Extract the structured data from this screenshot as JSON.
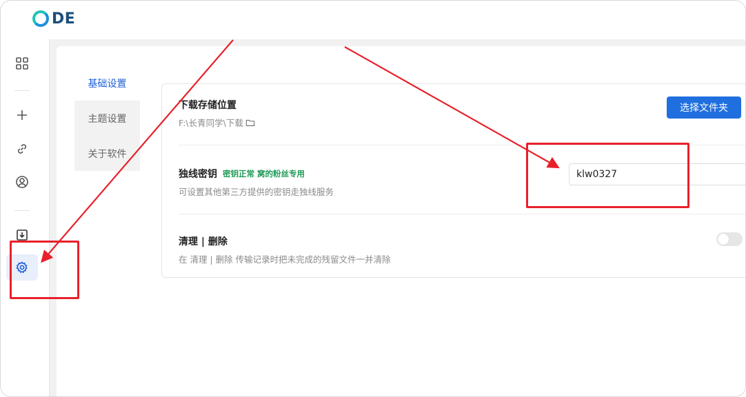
{
  "app": {
    "logo_text": "DE"
  },
  "sidebar": {
    "items": [
      {
        "icon": "grid-icon"
      },
      {
        "icon": "plus-icon"
      },
      {
        "icon": "link-icon"
      },
      {
        "icon": "user-circle-icon"
      },
      {
        "icon": "download-icon"
      },
      {
        "icon": "gear-icon",
        "active": true
      }
    ]
  },
  "subnav": {
    "items": [
      {
        "label": "基础设置",
        "active": true
      },
      {
        "label": "主题设置"
      },
      {
        "label": "关于软件"
      }
    ]
  },
  "settings": {
    "download": {
      "title": "下载存储位置",
      "path": "F:\\长青同学\\下载",
      "button_label": "选择文件夹"
    },
    "key": {
      "title": "独线密钥",
      "badge": "密钥正常 窝的粉丝专用",
      "desc": "可设置其他第三方提供的密钥走独线服务",
      "value": "klw0327"
    },
    "cleanup": {
      "title": "清理 | 删除",
      "desc": "在 清理 | 删除 传输记录时把未完成的残留文件一并清除",
      "enabled": false
    }
  },
  "colors": {
    "accent": "#1f6fde",
    "annotation": "#e8202a",
    "ok_badge": "#1f9b57"
  }
}
